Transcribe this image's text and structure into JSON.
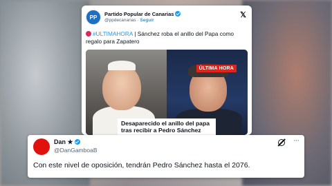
{
  "post1": {
    "avatar_text": "PP",
    "author_name": "Partido Popular de Canarias",
    "handle": "@ppdecanarias",
    "separator": " · ",
    "follow_label": "Seguir",
    "hashtag": "#ULTIMAHORA",
    "text": " | Sánchez roba el anillo del Papa como regalo para Zapatero",
    "media_badge": "ÚLTIMA HORA",
    "media_caption": "Desaparecido el anillo del papa tras recibir a Pedro Sánchez",
    "icons": {
      "platform": "x-logo-icon",
      "verified": "verified-badge-icon",
      "alert": "red-circle-icon"
    }
  },
  "post2": {
    "author_name": "Dan ★",
    "handle": "@DanGamboaB",
    "text": "Con este nivel de oposición, tendrán Pedro Sánchez hasta el 2076.",
    "icons": {
      "grok": "grok-icon",
      "more": "more-icon",
      "verified": "verified-badge-icon"
    },
    "avatar_color": "#e0120e"
  },
  "colors": {
    "link": "#1d9bf0",
    "alert_red": "#e0231b"
  }
}
